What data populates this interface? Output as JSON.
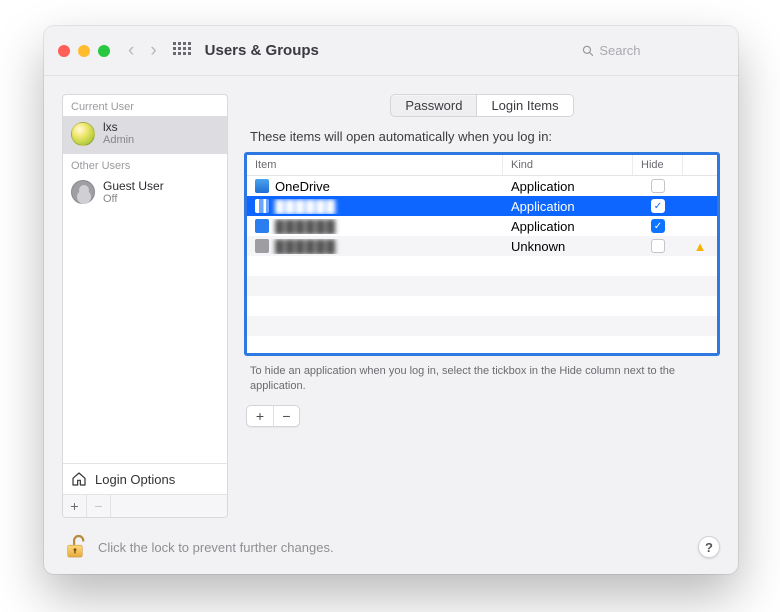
{
  "window": {
    "title": "Users & Groups"
  },
  "search": {
    "placeholder": "Search"
  },
  "sidebar": {
    "current_label": "Current User",
    "other_label": "Other Users",
    "current": {
      "name": "lxs",
      "role": "Admin"
    },
    "guest": {
      "name": "Guest User",
      "role": "Off"
    },
    "login_options": "Login Options"
  },
  "tabs": {
    "password": "Password",
    "login_items": "Login Items"
  },
  "intro": "These items will open automatically when you log in:",
  "columns": {
    "item": "Item",
    "kind": "Kind",
    "hide": "Hide"
  },
  "rows": [
    {
      "name": "OneDrive",
      "kind": "Application",
      "hide": false,
      "icon": "onedrive",
      "warn": false,
      "blurred": false,
      "selected": false
    },
    {
      "name": "██████",
      "kind": "Application",
      "hide": true,
      "icon": "blur1",
      "warn": false,
      "blurred": true,
      "selected": true
    },
    {
      "name": "██████",
      "kind": "Application",
      "hide": true,
      "icon": "blue",
      "warn": false,
      "blurred": true,
      "selected": false
    },
    {
      "name": "██████",
      "kind": "Unknown",
      "hide": false,
      "icon": "gray",
      "warn": true,
      "blurred": true,
      "selected": false
    }
  ],
  "hint": "To hide an application when you log in, select the tickbox in the Hide column next to the application.",
  "footer": {
    "lock_text": "Click the lock to prevent further changes."
  },
  "glyphs": {
    "plus": "+",
    "minus": "−",
    "check": "✓",
    "warn": "▲",
    "help": "?"
  }
}
